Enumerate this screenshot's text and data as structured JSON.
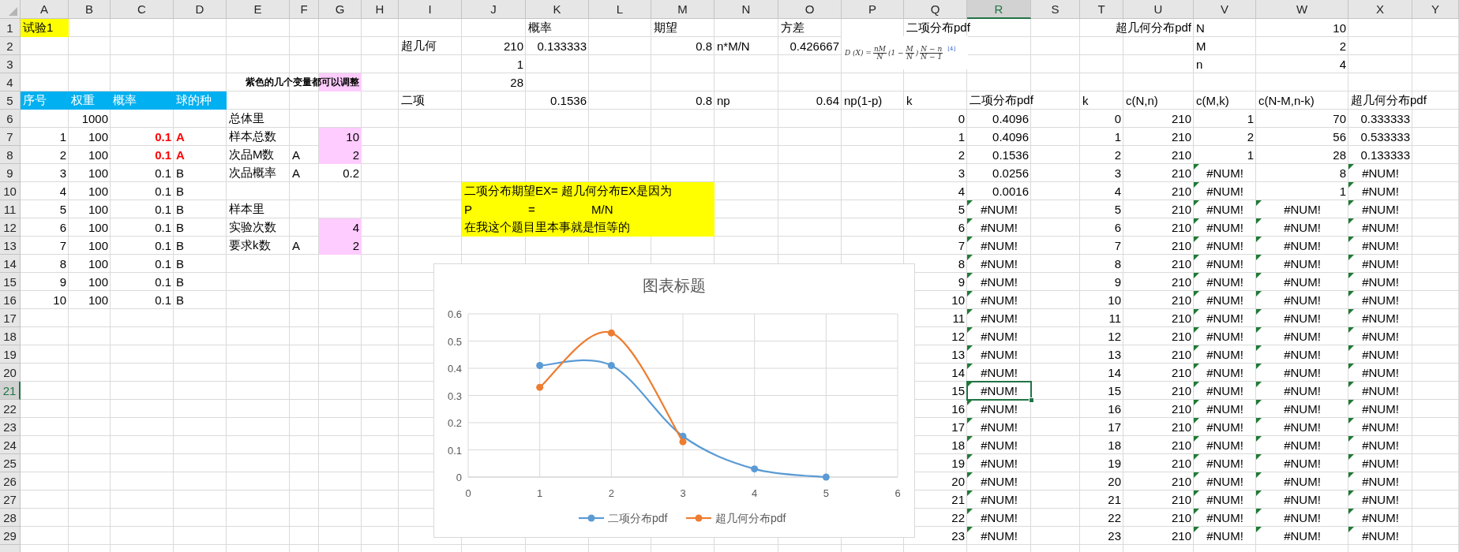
{
  "sheet": {
    "columns": [
      {
        "label": "A",
        "selected": false
      },
      {
        "label": "B",
        "selected": false
      },
      {
        "label": "C",
        "selected": false
      },
      {
        "label": "D",
        "selected": false
      },
      {
        "label": "E",
        "selected": false
      },
      {
        "label": "F",
        "selected": false
      },
      {
        "label": "G",
        "selected": false
      },
      {
        "label": "H",
        "selected": false
      },
      {
        "label": "I",
        "selected": false
      },
      {
        "label": "J",
        "selected": false
      },
      {
        "label": "K",
        "selected": false
      },
      {
        "label": "L",
        "selected": false
      },
      {
        "label": "M",
        "selected": false
      },
      {
        "label": "N",
        "selected": false
      },
      {
        "label": "O",
        "selected": false
      },
      {
        "label": "P",
        "selected": false
      },
      {
        "label": "Q",
        "selected": false
      },
      {
        "label": "R",
        "selected": true
      },
      {
        "label": "S",
        "selected": false
      },
      {
        "label": "T",
        "selected": false
      },
      {
        "label": "U",
        "selected": false
      },
      {
        "label": "V",
        "selected": false
      },
      {
        "label": "W",
        "selected": false
      },
      {
        "label": "X",
        "selected": false
      },
      {
        "label": "Y",
        "selected": false
      }
    ],
    "rows": [
      {
        "label": "1",
        "selected": false,
        "cells": {
          "A": {
            "text": "试验1",
            "kind": "text",
            "color": "#ffff00"
          },
          "K": {
            "text": "概率",
            "kind": "text"
          },
          "M": {
            "text": "期望",
            "kind": "text"
          },
          "O": {
            "text": "方差",
            "kind": "text"
          },
          "Q": {
            "text": "二项分布pdf",
            "kind": "text"
          },
          "U": {
            "text": "超几何分布pdf",
            "kind": "label"
          },
          "V": {
            "text": "N",
            "kind": "text"
          },
          "W": {
            "text": "10",
            "kind": "number"
          }
        }
      },
      {
        "label": "2",
        "selected": false,
        "cells": {
          "I": {
            "text": "超几何",
            "kind": "text"
          },
          "J": {
            "text": "210",
            "kind": "number"
          },
          "K": {
            "text": "0.133333",
            "kind": "number"
          },
          "M": {
            "text": "0.8",
            "kind": "number"
          },
          "N": {
            "text": "n*M/N",
            "kind": "text"
          },
          "O": {
            "text": "0.426667",
            "kind": "number"
          },
          "V": {
            "text": "M",
            "kind": "text"
          },
          "W": {
            "text": "2",
            "kind": "number"
          }
        }
      },
      {
        "label": "3",
        "selected": false,
        "cells": {
          "J": {
            "text": "1",
            "kind": "number"
          },
          "V": {
            "text": "n",
            "kind": "text"
          },
          "W": {
            "text": "4",
            "kind": "number"
          }
        }
      },
      {
        "label": "4",
        "selected": false,
        "cells": {
          "G": {
            "text": "紫色的几个变量都可以调整",
            "kind": "note",
            "color": "#ffccff"
          },
          "J": {
            "text": "28",
            "kind": "number"
          }
        }
      },
      {
        "label": "5",
        "selected": false,
        "cells": {
          "A": {
            "text": "序号",
            "kind": "text",
            "color": "#00b0f0"
          },
          "B": {
            "text": "权重",
            "kind": "text",
            "color": "#00b0f0"
          },
          "C": {
            "text": "概率",
            "kind": "text",
            "color": "#00b0f0"
          },
          "D": {
            "text": "球的种",
            "kind": "text",
            "color": "#00b0f0"
          },
          "I": {
            "text": "二项",
            "kind": "text"
          },
          "K": {
            "text": "0.1536",
            "kind": "number"
          },
          "M": {
            "text": "0.8",
            "kind": "number"
          },
          "N": {
            "text": "np",
            "kind": "text"
          },
          "O": {
            "text": "0.64",
            "kind": "number"
          },
          "P": {
            "text": "np(1-p)",
            "kind": "text"
          },
          "Q": {
            "text": "k",
            "kind": "text"
          },
          "R": {
            "text": "二项分布pdf",
            "kind": "text"
          },
          "T": {
            "text": "k",
            "kind": "text"
          },
          "U": {
            "text": "c(N,n)",
            "kind": "text"
          },
          "V": {
            "text": "c(M,k)",
            "kind": "text"
          },
          "W": {
            "text": "c(N-M,n-k)",
            "kind": "text"
          },
          "X": {
            "text": "超几何分布pdf",
            "kind": "text"
          }
        }
      },
      {
        "label": "6",
        "selected": false,
        "cells": {
          "B": {
            "text": "1000",
            "kind": "number"
          },
          "E": {
            "text": "总体里",
            "kind": "text"
          },
          "Q": {
            "text": "0",
            "kind": "number"
          },
          "R": {
            "text": "0.4096",
            "kind": "number"
          },
          "T": {
            "text": "0",
            "kind": "number"
          },
          "U": {
            "text": "210",
            "kind": "number"
          },
          "V": {
            "text": "1",
            "kind": "number"
          },
          "W": {
            "text": "70",
            "kind": "number"
          },
          "X": {
            "text": "0.333333",
            "kind": "number"
          }
        }
      },
      {
        "label": "7",
        "selected": false,
        "cells": {
          "A": {
            "text": "1",
            "kind": "number"
          },
          "B": {
            "text": "100",
            "kind": "number"
          },
          "C": {
            "text": "0.1",
            "kind": "number",
            "emphasis": true
          },
          "D": {
            "text": "A",
            "kind": "text",
            "emphasis": true
          },
          "E": {
            "text": "样本总数",
            "kind": "text"
          },
          "G": {
            "text": "10",
            "kind": "number",
            "color": "#ffccff"
          },
          "Q": {
            "text": "1",
            "kind": "number"
          },
          "R": {
            "text": "0.4096",
            "kind": "number"
          },
          "T": {
            "text": "1",
            "kind": "number"
          },
          "U": {
            "text": "210",
            "kind": "number"
          },
          "V": {
            "text": "2",
            "kind": "number"
          },
          "W": {
            "text": "56",
            "kind": "number"
          },
          "X": {
            "text": "0.533333",
            "kind": "number"
          }
        }
      },
      {
        "label": "8",
        "selected": false,
        "cells": {
          "A": {
            "text": "2",
            "kind": "number"
          },
          "B": {
            "text": "100",
            "kind": "number"
          },
          "C": {
            "text": "0.1",
            "kind": "number",
            "emphasis": true
          },
          "D": {
            "text": "A",
            "kind": "text",
            "emphasis": true
          },
          "E": {
            "text": "次品M数",
            "kind": "text"
          },
          "F": {
            "text": "A",
            "kind": "text"
          },
          "G": {
            "text": "2",
            "kind": "number",
            "color": "#ffccff"
          },
          "Q": {
            "text": "2",
            "kind": "number"
          },
          "R": {
            "text": "0.1536",
            "kind": "number"
          },
          "T": {
            "text": "2",
            "kind": "number"
          },
          "U": {
            "text": "210",
            "kind": "number"
          },
          "V": {
            "text": "1",
            "kind": "number"
          },
          "W": {
            "text": "28",
            "kind": "number"
          },
          "X": {
            "text": "0.133333",
            "kind": "number"
          }
        }
      },
      {
        "label": "9",
        "selected": false,
        "cells": {
          "A": {
            "text": "3",
            "kind": "number"
          },
          "B": {
            "text": "100",
            "kind": "number"
          },
          "C": {
            "text": "0.1",
            "kind": "number"
          },
          "D": {
            "text": "B",
            "kind": "text"
          },
          "E": {
            "text": "次品概率",
            "kind": "text"
          },
          "F": {
            "text": "A",
            "kind": "text"
          },
          "G": {
            "text": "0.2",
            "kind": "number"
          },
          "Q": {
            "text": "3",
            "kind": "number"
          },
          "R": {
            "text": "0.0256",
            "kind": "number"
          },
          "T": {
            "text": "3",
            "kind": "number"
          },
          "U": {
            "text": "210",
            "kind": "number"
          },
          "V": {
            "text": "#NUM!",
            "kind": "error",
            "flag": true
          },
          "W": {
            "text": "8",
            "kind": "number"
          },
          "X": {
            "text": "#NUM!",
            "kind": "error",
            "flag": true
          }
        }
      },
      {
        "label": "10",
        "selected": false,
        "cells": {
          "A": {
            "text": "4",
            "kind": "number"
          },
          "B": {
            "text": "100",
            "kind": "number"
          },
          "C": {
            "text": "0.1",
            "kind": "number"
          },
          "D": {
            "text": "B",
            "kind": "text"
          },
          "J": {
            "text": "二项分布期望EX= 超几何分布EX是因为",
            "kind": "text",
            "color": "#ffff00"
          },
          "K": {
            "color": "#ffff00"
          },
          "L": {
            "color": "#ffff00"
          },
          "M": {
            "color": "#ffff00"
          },
          "Q": {
            "text": "4",
            "kind": "number"
          },
          "R": {
            "text": "0.0016",
            "kind": "number"
          },
          "T": {
            "text": "4",
            "kind": "number"
          },
          "U": {
            "text": "210",
            "kind": "number"
          },
          "V": {
            "text": "#NUM!",
            "kind": "error",
            "flag": true
          },
          "W": {
            "text": "1",
            "kind": "number"
          },
          "X": {
            "text": "#NUM!",
            "kind": "error",
            "flag": true
          }
        }
      },
      {
        "label": "11",
        "selected": false,
        "cells": {
          "A": {
            "text": "5",
            "kind": "number"
          },
          "B": {
            "text": "100",
            "kind": "number"
          },
          "C": {
            "text": "0.1",
            "kind": "number"
          },
          "D": {
            "text": "B",
            "kind": "text"
          },
          "E": {
            "text": "样本里",
            "kind": "text"
          },
          "J": {
            "text": "P",
            "kind": "text",
            "color": "#ffff00"
          },
          "K": {
            "text": "=",
            "kind": "text",
            "color": "#ffff00"
          },
          "L": {
            "text": "M/N",
            "kind": "text",
            "color": "#ffff00"
          },
          "M": {
            "color": "#ffff00"
          },
          "Q": {
            "text": "5",
            "kind": "number"
          },
          "R": {
            "text": "#NUM!",
            "kind": "error",
            "flag": true
          },
          "T": {
            "text": "5",
            "kind": "number"
          },
          "U": {
            "text": "210",
            "kind": "number"
          },
          "V": {
            "text": "#NUM!",
            "kind": "error",
            "flag": true
          },
          "W": {
            "text": "#NUM!",
            "kind": "error",
            "flag": true
          },
          "X": {
            "text": "#NUM!",
            "kind": "error",
            "flag": true
          }
        }
      },
      {
        "label": "12",
        "selected": false,
        "cells": {
          "A": {
            "text": "6",
            "kind": "number"
          },
          "B": {
            "text": "100",
            "kind": "number"
          },
          "C": {
            "text": "0.1",
            "kind": "number"
          },
          "D": {
            "text": "B",
            "kind": "text"
          },
          "E": {
            "text": "实验次数",
            "kind": "text"
          },
          "G": {
            "text": "4",
            "kind": "number",
            "color": "#ffccff"
          },
          "J": {
            "text": "在我这个题目里本事就是恒等的",
            "kind": "text",
            "color": "#ffff00"
          },
          "K": {
            "color": "#ffff00"
          },
          "L": {
            "color": "#ffff00"
          },
          "M": {
            "color": "#ffff00"
          },
          "Q": {
            "text": "6",
            "kind": "number"
          },
          "R": {
            "text": "#NUM!",
            "kind": "error",
            "flag": true
          },
          "T": {
            "text": "6",
            "kind": "number"
          },
          "U": {
            "text": "210",
            "kind": "number"
          },
          "V": {
            "text": "#NUM!",
            "kind": "error",
            "flag": true
          },
          "W": {
            "text": "#NUM!",
            "kind": "error",
            "flag": true
          },
          "X": {
            "text": "#NUM!",
            "kind": "error",
            "flag": true
          }
        }
      },
      {
        "label": "13",
        "selected": false,
        "cells": {
          "A": {
            "text": "7",
            "kind": "number"
          },
          "B": {
            "text": "100",
            "kind": "number"
          },
          "C": {
            "text": "0.1",
            "kind": "number"
          },
          "D": {
            "text": "B",
            "kind": "text"
          },
          "E": {
            "text": "要求k数",
            "kind": "text"
          },
          "F": {
            "text": "A",
            "kind": "text"
          },
          "G": {
            "text": "2",
            "kind": "number",
            "color": "#ffccff"
          },
          "Q": {
            "text": "7",
            "kind": "number"
          },
          "R": {
            "text": "#NUM!",
            "kind": "error",
            "flag": true
          },
          "T": {
            "text": "7",
            "kind": "number"
          },
          "U": {
            "text": "210",
            "kind": "number"
          },
          "V": {
            "text": "#NUM!",
            "kind": "error",
            "flag": true
          },
          "W": {
            "text": "#NUM!",
            "kind": "error",
            "flag": true
          },
          "X": {
            "text": "#NUM!",
            "kind": "error",
            "flag": true
          }
        }
      },
      {
        "label": "14",
        "selected": false,
        "cells": {
          "A": {
            "text": "8",
            "kind": "number"
          },
          "B": {
            "text": "100",
            "kind": "number"
          },
          "C": {
            "text": "0.1",
            "kind": "number"
          },
          "D": {
            "text": "B",
            "kind": "text"
          },
          "Q": {
            "text": "8",
            "kind": "number"
          },
          "R": {
            "text": "#NUM!",
            "kind": "error",
            "flag": true
          },
          "T": {
            "text": "8",
            "kind": "number"
          },
          "U": {
            "text": "210",
            "kind": "number"
          },
          "V": {
            "text": "#NUM!",
            "kind": "error",
            "flag": true
          },
          "W": {
            "text": "#NUM!",
            "kind": "error",
            "flag": true
          },
          "X": {
            "text": "#NUM!",
            "kind": "error",
            "flag": true
          }
        }
      },
      {
        "label": "15",
        "selected": false,
        "cells": {
          "A": {
            "text": "9",
            "kind": "number"
          },
          "B": {
            "text": "100",
            "kind": "number"
          },
          "C": {
            "text": "0.1",
            "kind": "number"
          },
          "D": {
            "text": "B",
            "kind": "text"
          },
          "Q": {
            "text": "9",
            "kind": "number"
          },
          "R": {
            "text": "#NUM!",
            "kind": "error",
            "flag": true
          },
          "T": {
            "text": "9",
            "kind": "number"
          },
          "U": {
            "text": "210",
            "kind": "number"
          },
          "V": {
            "text": "#NUM!",
            "kind": "error",
            "flag": true
          },
          "W": {
            "text": "#NUM!",
            "kind": "error",
            "flag": true
          },
          "X": {
            "text": "#NUM!",
            "kind": "error",
            "flag": true
          }
        }
      },
      {
        "label": "16",
        "selected": false,
        "cells": {
          "A": {
            "text": "10",
            "kind": "number"
          },
          "B": {
            "text": "100",
            "kind": "number"
          },
          "C": {
            "text": "0.1",
            "kind": "number"
          },
          "D": {
            "text": "B",
            "kind": "text"
          },
          "Q": {
            "text": "10",
            "kind": "number"
          },
          "R": {
            "text": "#NUM!",
            "kind": "error",
            "flag": true
          },
          "T": {
            "text": "10",
            "kind": "number"
          },
          "U": {
            "text": "210",
            "kind": "number"
          },
          "V": {
            "text": "#NUM!",
            "kind": "error",
            "flag": true
          },
          "W": {
            "text": "#NUM!",
            "kind": "error",
            "flag": true
          },
          "X": {
            "text": "#NUM!",
            "kind": "error",
            "flag": true
          }
        }
      },
      {
        "label": "17",
        "selected": false,
        "cells": {
          "Q": {
            "text": "11",
            "kind": "number"
          },
          "R": {
            "text": "#NUM!",
            "kind": "error",
            "flag": true
          },
          "T": {
            "text": "11",
            "kind": "number"
          },
          "U": {
            "text": "210",
            "kind": "number"
          },
          "V": {
            "text": "#NUM!",
            "kind": "error",
            "flag": true
          },
          "W": {
            "text": "#NUM!",
            "kind": "error",
            "flag": true
          },
          "X": {
            "text": "#NUM!",
            "kind": "error",
            "flag": true
          }
        }
      },
      {
        "label": "18",
        "selected": false,
        "cells": {
          "Q": {
            "text": "12",
            "kind": "number"
          },
          "R": {
            "text": "#NUM!",
            "kind": "error",
            "flag": true
          },
          "T": {
            "text": "12",
            "kind": "number"
          },
          "U": {
            "text": "210",
            "kind": "number"
          },
          "V": {
            "text": "#NUM!",
            "kind": "error",
            "flag": true
          },
          "W": {
            "text": "#NUM!",
            "kind": "error",
            "flag": true
          },
          "X": {
            "text": "#NUM!",
            "kind": "error",
            "flag": true
          }
        }
      },
      {
        "label": "19",
        "selected": false,
        "cells": {
          "Q": {
            "text": "13",
            "kind": "number"
          },
          "R": {
            "text": "#NUM!",
            "kind": "error",
            "flag": true
          },
          "T": {
            "text": "13",
            "kind": "number"
          },
          "U": {
            "text": "210",
            "kind": "number"
          },
          "V": {
            "text": "#NUM!",
            "kind": "error",
            "flag": true
          },
          "W": {
            "text": "#NUM!",
            "kind": "error",
            "flag": true
          },
          "X": {
            "text": "#NUM!",
            "kind": "error",
            "flag": true
          }
        }
      },
      {
        "label": "20",
        "selected": false,
        "cells": {
          "Q": {
            "text": "14",
            "kind": "number"
          },
          "R": {
            "text": "#NUM!",
            "kind": "error",
            "flag": true
          },
          "T": {
            "text": "14",
            "kind": "number"
          },
          "U": {
            "text": "210",
            "kind": "number"
          },
          "V": {
            "text": "#NUM!",
            "kind": "error",
            "flag": true
          },
          "W": {
            "text": "#NUM!",
            "kind": "error",
            "flag": true
          },
          "X": {
            "text": "#NUM!",
            "kind": "error",
            "flag": true
          }
        }
      },
      {
        "label": "21",
        "selected": true,
        "cells": {
          "Q": {
            "text": "15",
            "kind": "number"
          },
          "R": {
            "text": "#NUM!",
            "kind": "error",
            "flag": true
          },
          "T": {
            "text": "15",
            "kind": "number"
          },
          "U": {
            "text": "210",
            "kind": "number"
          },
          "V": {
            "text": "#NUM!",
            "kind": "error",
            "flag": true
          },
          "W": {
            "text": "#NUM!",
            "kind": "error",
            "flag": true
          },
          "X": {
            "text": "#NUM!",
            "kind": "error",
            "flag": true
          }
        }
      },
      {
        "label": "22",
        "selected": false,
        "cells": {
          "Q": {
            "text": "16",
            "kind": "number"
          },
          "R": {
            "text": "#NUM!",
            "kind": "error",
            "flag": true
          },
          "T": {
            "text": "16",
            "kind": "number"
          },
          "U": {
            "text": "210",
            "kind": "number"
          },
          "V": {
            "text": "#NUM!",
            "kind": "error",
            "flag": true
          },
          "W": {
            "text": "#NUM!",
            "kind": "error",
            "flag": true
          },
          "X": {
            "text": "#NUM!",
            "kind": "error",
            "flag": true
          }
        }
      },
      {
        "label": "23",
        "selected": false,
        "cells": {
          "Q": {
            "text": "17",
            "kind": "number"
          },
          "R": {
            "text": "#NUM!",
            "kind": "error",
            "flag": true
          },
          "T": {
            "text": "17",
            "kind": "number"
          },
          "U": {
            "text": "210",
            "kind": "number"
          },
          "V": {
            "text": "#NUM!",
            "kind": "error",
            "flag": true
          },
          "W": {
            "text": "#NUM!",
            "kind": "error",
            "flag": true
          },
          "X": {
            "text": "#NUM!",
            "kind": "error",
            "flag": true
          }
        }
      },
      {
        "label": "24",
        "selected": false,
        "cells": {
          "Q": {
            "text": "18",
            "kind": "number"
          },
          "R": {
            "text": "#NUM!",
            "kind": "error",
            "flag": true
          },
          "T": {
            "text": "18",
            "kind": "number"
          },
          "U": {
            "text": "210",
            "kind": "number"
          },
          "V": {
            "text": "#NUM!",
            "kind": "error",
            "flag": true
          },
          "W": {
            "text": "#NUM!",
            "kind": "error",
            "flag": true
          },
          "X": {
            "text": "#NUM!",
            "kind": "error",
            "flag": true
          }
        }
      },
      {
        "label": "25",
        "selected": false,
        "cells": {
          "Q": {
            "text": "19",
            "kind": "number"
          },
          "R": {
            "text": "#NUM!",
            "kind": "error",
            "flag": true
          },
          "T": {
            "text": "19",
            "kind": "number"
          },
          "U": {
            "text": "210",
            "kind": "number"
          },
          "V": {
            "text": "#NUM!",
            "kind": "error",
            "flag": true
          },
          "W": {
            "text": "#NUM!",
            "kind": "error",
            "flag": true
          },
          "X": {
            "text": "#NUM!",
            "kind": "error",
            "flag": true
          }
        }
      },
      {
        "label": "26",
        "selected": false,
        "cells": {
          "Q": {
            "text": "20",
            "kind": "number"
          },
          "R": {
            "text": "#NUM!",
            "kind": "error",
            "flag": true
          },
          "T": {
            "text": "20",
            "kind": "number"
          },
          "U": {
            "text": "210",
            "kind": "number"
          },
          "V": {
            "text": "#NUM!",
            "kind": "error",
            "flag": true
          },
          "W": {
            "text": "#NUM!",
            "kind": "error",
            "flag": true
          },
          "X": {
            "text": "#NUM!",
            "kind": "error",
            "flag": true
          }
        }
      },
      {
        "label": "27",
        "selected": false,
        "cells": {
          "Q": {
            "text": "21",
            "kind": "number"
          },
          "R": {
            "text": "#NUM!",
            "kind": "error",
            "flag": true
          },
          "T": {
            "text": "21",
            "kind": "number"
          },
          "U": {
            "text": "210",
            "kind": "number"
          },
          "V": {
            "text": "#NUM!",
            "kind": "error",
            "flag": true
          },
          "W": {
            "text": "#NUM!",
            "kind": "error",
            "flag": true
          },
          "X": {
            "text": "#NUM!",
            "kind": "error",
            "flag": true
          }
        }
      },
      {
        "label": "28",
        "selected": false,
        "cells": {
          "Q": {
            "text": "22",
            "kind": "number"
          },
          "R": {
            "text": "#NUM!",
            "kind": "error",
            "flag": true
          },
          "T": {
            "text": "22",
            "kind": "number"
          },
          "U": {
            "text": "210",
            "kind": "number"
          },
          "V": {
            "text": "#NUM!",
            "kind": "error",
            "flag": true
          },
          "W": {
            "text": "#NUM!",
            "kind": "error",
            "flag": true
          },
          "X": {
            "text": "#NUM!",
            "kind": "error",
            "flag": true
          }
        }
      },
      {
        "label": "29",
        "selected": false,
        "cells": {
          "Q": {
            "text": "23",
            "kind": "number"
          },
          "R": {
            "text": "#NUM!",
            "kind": "error",
            "flag": true
          },
          "T": {
            "text": "23",
            "kind": "number"
          },
          "U": {
            "text": "210",
            "kind": "number"
          },
          "V": {
            "text": "#NUM!",
            "kind": "error",
            "flag": true
          },
          "W": {
            "text": "#NUM!",
            "kind": "error",
            "flag": true
          },
          "X": {
            "text": "#NUM!",
            "kind": "error",
            "flag": true
          }
        }
      }
    ]
  },
  "formula": {
    "parts": [
      {
        "kind": "text",
        "text": "D (X) ="
      },
      {
        "kind": "frac",
        "num": "nM",
        "den": "N"
      },
      {
        "kind": "text",
        "text": "(1 −"
      },
      {
        "kind": "frac",
        "num": "M",
        "den": "N"
      },
      {
        "kind": "text",
        "text": ")"
      },
      {
        "kind": "frac",
        "num": "N − n",
        "den": "N − 1"
      },
      {
        "kind": "ref",
        "text": "[4]"
      }
    ]
  },
  "chart": {
    "chart_data": {
      "type": "line",
      "title": "图表标题",
      "x": [
        1,
        2,
        3,
        4,
        5
      ],
      "series": [
        {
          "name": "二项分布pdf",
          "color": "#5b9bd5",
          "marker": "circle",
          "values": [
            0.41,
            0.41,
            0.15,
            0.03,
            0.0
          ]
        },
        {
          "name": "超几何分布pdf",
          "color": "#ed7d31",
          "marker": "circle",
          "values": [
            0.33,
            0.53,
            0.13,
            null,
            null
          ]
        }
      ],
      "xlim": [
        0,
        6
      ],
      "ylim": [
        0,
        0.6
      ],
      "xticks": [
        0,
        1,
        2,
        3,
        4,
        5,
        6
      ],
      "yticks": [
        0,
        0.1,
        0.2,
        0.3,
        0.4,
        0.5,
        0.6
      ],
      "grid": true,
      "legend": true
    }
  }
}
